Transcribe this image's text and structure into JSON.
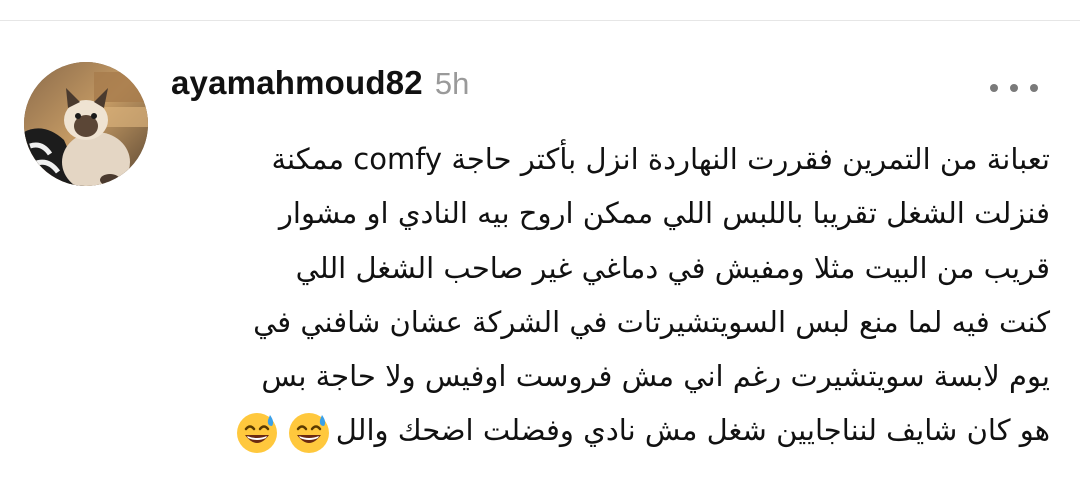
{
  "post": {
    "username": "ayamahmoud82",
    "timestamp": "5h",
    "lines": [
      "تعبانة من التمرين فقررت النهاردة انزل بأكتر حاجة comfy ممكنة",
      "فنزلت الشغل تقريبا باللبس اللي ممكن اروح بيه النادي او مشوار",
      "قريب من البيت مثلا ومفيش في دماغي غير صاحب الشغل اللي",
      "كنت فيه لما منع لبس السويتشيرتات في الشركة عشان شافني في",
      "يوم لابسة سويتشيرت رغم اني مش فروست اوفيس ولا حاجة بس",
      "هو كان شايف لنناجايين شغل مش نادي وفضلت اضحك والل"
    ],
    "emojis": [
      "sweat-smile-emoji",
      "sweat-smile-emoji"
    ]
  },
  "avatar": {
    "icon": "cat-photo-avatar"
  },
  "menu": {
    "icon": "more-options-icon"
  },
  "colors": {
    "text": "#111111",
    "muted": "#9a9a9a",
    "divider": "#e6e6e6",
    "dots": "#7a7a7a"
  }
}
